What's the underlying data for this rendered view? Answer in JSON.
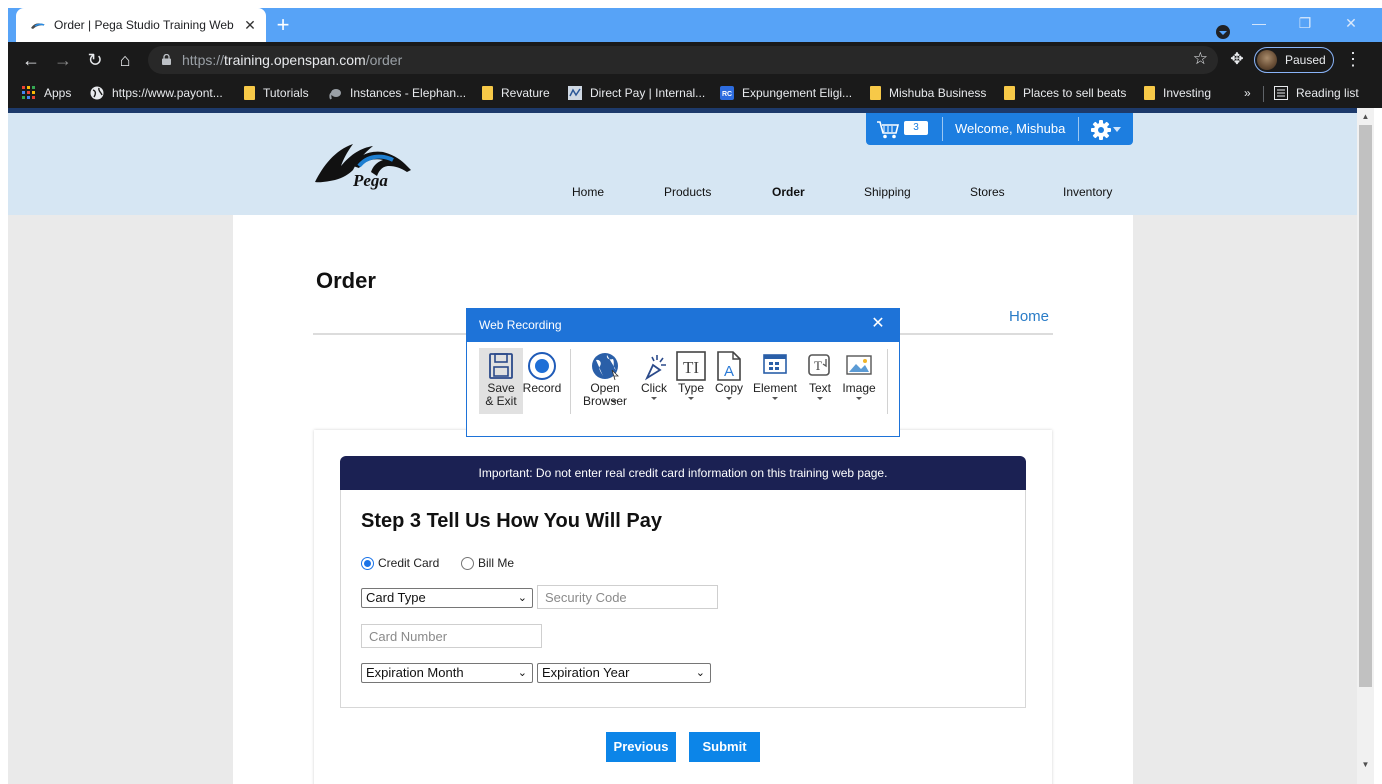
{
  "browser": {
    "tab_title": "Order | Pega Studio Training Web",
    "tab_close": "✕",
    "new_tab": "+",
    "url_scheme": "https://",
    "url_domain": "training.openspan.com",
    "url_path": "/order",
    "profile_status": "Paused",
    "bookmarks": [
      {
        "label": "Apps",
        "icon": "apps-grid-icon"
      },
      {
        "label": "https://www.payont...",
        "icon": "globe-icon"
      },
      {
        "label": "Tutorials",
        "icon": "folder-icon"
      },
      {
        "label": "Instances - Elephan...",
        "icon": "elephant-icon"
      },
      {
        "label": "Revature",
        "icon": "folder-icon"
      },
      {
        "label": "Direct Pay | Internal...",
        "icon": "irs-icon"
      },
      {
        "label": "Expungement Eligi...",
        "icon": "rc-icon"
      },
      {
        "label": "Mishuba Business",
        "icon": "folder-icon"
      },
      {
        "label": "Places to sell beats",
        "icon": "folder-icon"
      },
      {
        "label": "Investing",
        "icon": "folder-icon"
      }
    ],
    "bookmarks_overflow": "»",
    "reading_list": "Reading list"
  },
  "site": {
    "logo_text": "Pega",
    "nav": [
      "Home",
      "Products",
      "Order",
      "Shipping",
      "Stores",
      "Inventory"
    ],
    "nav_active": "Order",
    "cart_count": "3",
    "welcome": "Welcome, Mishuba"
  },
  "page": {
    "title": "Order",
    "home_link": "Home",
    "warning": "Important: Do not enter real credit card information on this training web page.",
    "step_title": "Step 3 Tell Us How You Will Pay",
    "payment_options": [
      "Credit Card",
      "Bill Me"
    ],
    "payment_selected": "Credit Card",
    "card_type": "Card Type",
    "security_code_placeholder": "Security Code",
    "card_number_placeholder": "Card Number",
    "expiration_month": "Expiration Month",
    "expiration_year": "Expiration Year",
    "previous_label": "Previous",
    "submit_label": "Submit"
  },
  "recorder": {
    "title": "Web Recording",
    "tools": [
      {
        "label": "Save & Exit",
        "icon": "save-icon"
      },
      {
        "label": "Record",
        "icon": "record-icon"
      },
      {
        "label": "Open Browser",
        "icon": "globe-icon"
      },
      {
        "label": "Click",
        "icon": "click-cursor-icon"
      },
      {
        "label": "Type",
        "icon": "type-text-icon"
      },
      {
        "label": "Copy",
        "icon": "copy-document-icon"
      },
      {
        "label": "Element",
        "icon": "element-icon"
      },
      {
        "label": "Text",
        "icon": "text-icon"
      },
      {
        "label": "Image",
        "icon": "image-icon"
      }
    ]
  },
  "colors": {
    "tabstrip": "#57a3f7",
    "header_bg": "#d6e6f3",
    "utility_bar": "#1d7ee0",
    "warning_bar": "#1b2153",
    "button": "#0c85e8",
    "recorder_header": "#1e73d8"
  }
}
